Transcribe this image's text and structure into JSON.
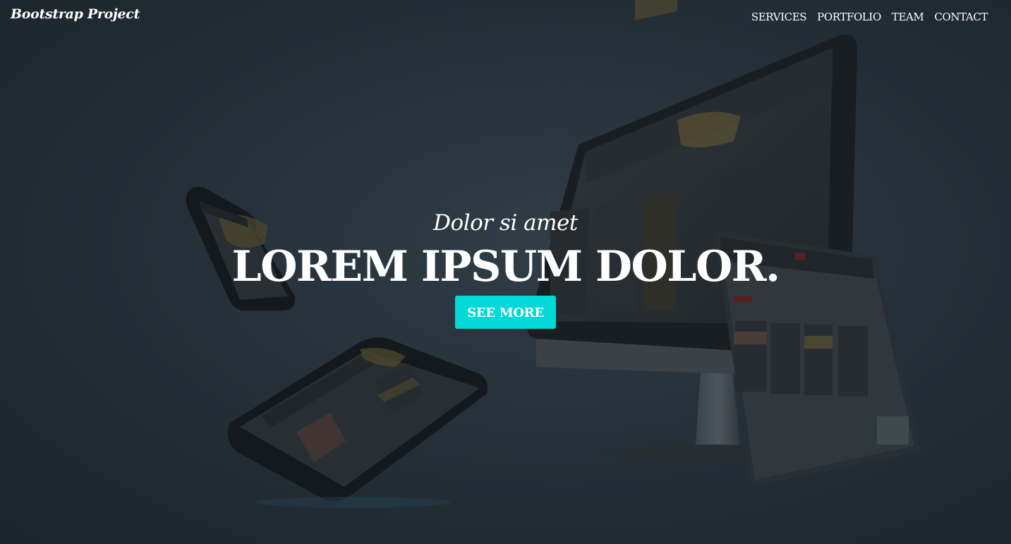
{
  "navbar": {
    "brand": "Bootstrap Project",
    "links": [
      "SERVICES",
      "PORTFOLIO",
      "TEAM",
      "CONTACT"
    ]
  },
  "hero": {
    "subheading": "Dolor si amet",
    "heading": "LOREM IPSUM DOLOR.",
    "cta_label": "SEE MORE"
  },
  "colors": {
    "overlay": "#1e272e",
    "accent": "#00d9d5",
    "text": "#ffffff"
  }
}
